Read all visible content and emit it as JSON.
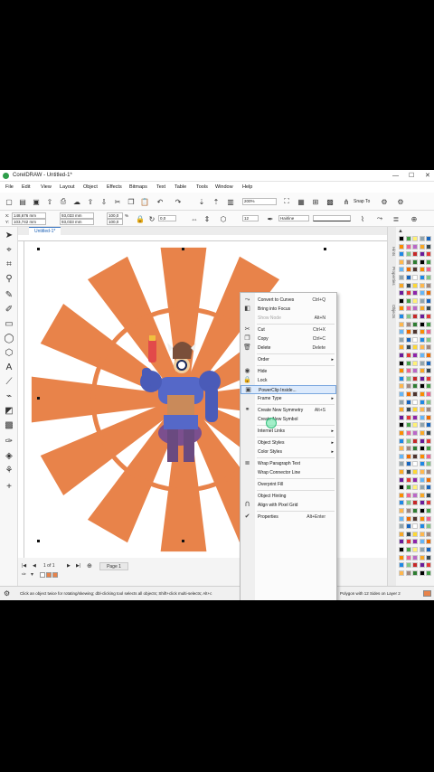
{
  "window": {
    "title": "CorelDRAW - Untitled-1*",
    "minimize": "—",
    "maximize": "☐",
    "close": "✕"
  },
  "menu": [
    "File",
    "Edit",
    "View",
    "Layout",
    "Object",
    "Effects",
    "Bitmaps",
    "Text",
    "Table",
    "Tools",
    "Window",
    "Help"
  ],
  "toolbar": {
    "zoom": "200%",
    "snap_label": "Snap To"
  },
  "propbar": {
    "x": "148,676 mm",
    "y": "103,742 mm",
    "w": "93,033 mm",
    "h": "93,033 mm",
    "scale_x": "100,0",
    "scale_y": "100,0",
    "pct": "%",
    "angle": "0,0",
    "sides": "12",
    "outline": "Hairline"
  },
  "doc_tab": "Untitled-1*",
  "pagenav": {
    "pages": "1 of 1",
    "page_tab": "Page 1"
  },
  "status": {
    "hint": "Click an object twice for rotating/skewing; dbl-clicking tool selects all objects; Shift+click multi-selects; Alt+c",
    "selection": "Polygon with 12 Sides on Layer 2"
  },
  "dockers": [
    "Hints",
    "Properties",
    "Objects"
  ],
  "colors": {
    "orange": "#e8834a",
    "accent": "#3b78c4",
    "highlight": "#dceafc"
  },
  "context_menu": [
    {
      "label": "Convert to Curves",
      "shortcut": "Ctrl+Q",
      "icon": "curves-icon",
      "glyph": "⤳"
    },
    {
      "label": "Bring into Focus",
      "icon": "focus-icon",
      "glyph": "◧"
    },
    {
      "label": "Show Node",
      "shortcut": "Alt+N",
      "disabled": true
    },
    {
      "sep": true
    },
    {
      "label": "Cut",
      "shortcut": "Ctrl+X",
      "icon": "cut-icon",
      "glyph": "✂"
    },
    {
      "label": "Copy",
      "shortcut": "Ctrl+C",
      "icon": "copy-icon",
      "glyph": "❐"
    },
    {
      "label": "Delete",
      "shortcut": "Delete",
      "icon": "trash-icon",
      "glyph": "🗑"
    },
    {
      "sep": true
    },
    {
      "label": "Order",
      "arrow": true
    },
    {
      "sep": true
    },
    {
      "label": "Hide",
      "icon": "eye-icon",
      "glyph": "◉"
    },
    {
      "label": "Lock",
      "icon": "lock-icon",
      "glyph": "🔒"
    },
    {
      "label": "PowerClip Inside...",
      "highlight": true,
      "icon": "powerclip-icon",
      "glyph": "▣"
    },
    {
      "label": "Frame Type",
      "arrow": true
    },
    {
      "sep": true
    },
    {
      "label": "Create New Symmetry",
      "shortcut": "Alt+S",
      "icon": "symmetry-icon",
      "glyph": "⚭"
    },
    {
      "label": "Create New Symbol"
    },
    {
      "sep": true
    },
    {
      "label": "Internet Links",
      "arrow": true
    },
    {
      "sep": true
    },
    {
      "label": "Object Styles",
      "arrow": true
    },
    {
      "label": "Color Styles",
      "arrow": true
    },
    {
      "sep": true
    },
    {
      "label": "Wrap Paragraph Text",
      "icon": "wrap-icon",
      "glyph": "≣"
    },
    {
      "label": "Wrap Connector Line"
    },
    {
      "sep": true
    },
    {
      "label": "Overprint Fill"
    },
    {
      "sep": true
    },
    {
      "label": "Object Hinting"
    },
    {
      "label": "Align with Pixel Grid",
      "icon": "magnet-icon",
      "glyph": "Ո"
    },
    {
      "sep": true
    },
    {
      "label": "Properties",
      "shortcut": "Alt+Enter",
      "icon": "check-icon",
      "glyph": "✔"
    }
  ]
}
